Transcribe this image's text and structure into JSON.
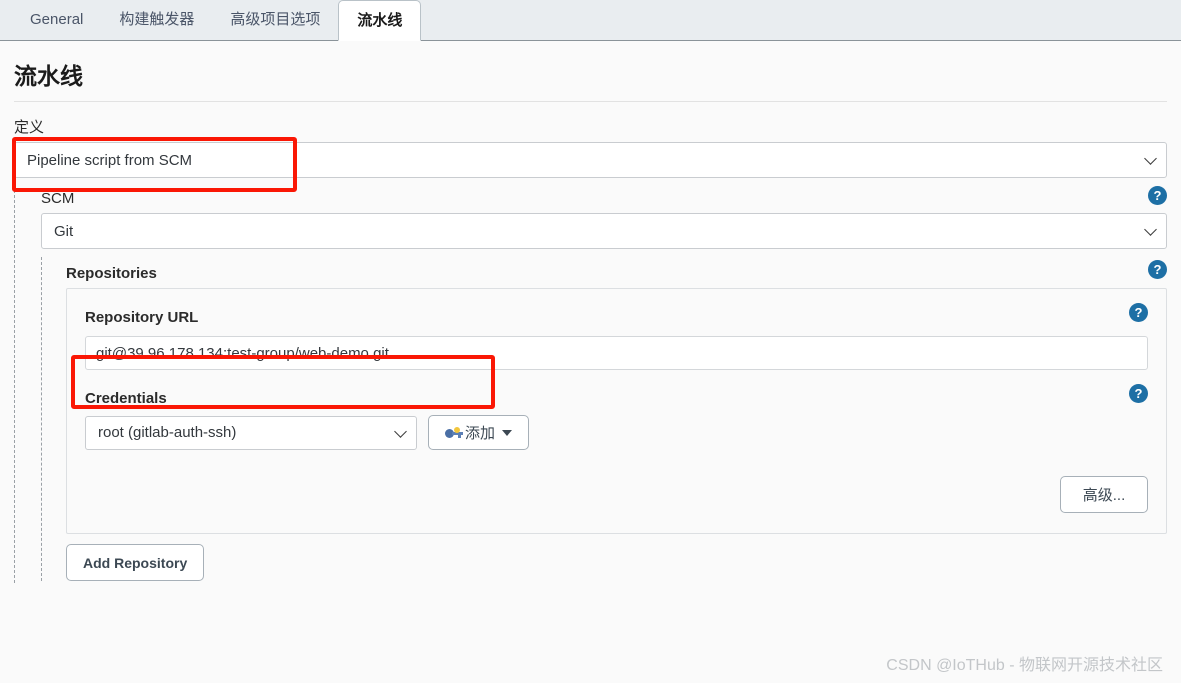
{
  "tabs": [
    {
      "label": "General",
      "active": false
    },
    {
      "label": "构建触发器",
      "active": false
    },
    {
      "label": "高级项目选项",
      "active": false
    },
    {
      "label": "流水线",
      "active": true
    }
  ],
  "page": {
    "title": "流水线",
    "definition_label": "定义",
    "definition_value": "Pipeline script from SCM"
  },
  "scm": {
    "label": "SCM",
    "value": "Git",
    "help": "?"
  },
  "repositories": {
    "label": "Repositories",
    "help": "?",
    "repository_url": {
      "label": "Repository URL",
      "value": "git@39.96.178.134:test-group/web-demo.git",
      "help": "?"
    },
    "credentials": {
      "label": "Credentials",
      "value": "root (gitlab-auth-ssh)",
      "help": "?",
      "add_button": "添加",
      "key_icon": "key-icon",
      "caret_icon": "caret-down-icon"
    },
    "advanced_button": "高级...",
    "add_repository_button": "Add Repository"
  },
  "watermark": "CSDN @IoTHub - 物联网开源技术社区",
  "colors": {
    "annotation": "#fa1705",
    "help_blue": "#1d6fa5",
    "tabbar_bg": "#e9edf0",
    "page_bg": "#fafafa"
  }
}
